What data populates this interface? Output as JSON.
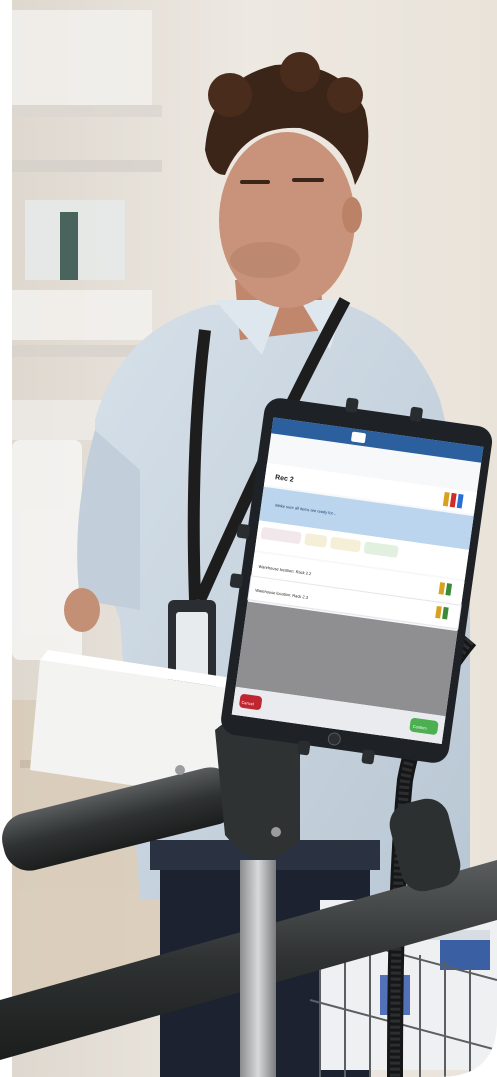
{
  "photo": {
    "alt_subject": "stockroom-worker-with-tablet-on-cart",
    "colors": {
      "wall": "#ece7df",
      "shirt": "#c9d6e2",
      "hair": "#3b2418",
      "skin": "#c8937a",
      "lanyard": "#1d1d1d",
      "cart_frame": "#3a3c3c",
      "tablet_body": "#1e2226",
      "app_header": "#2b5f9e",
      "app_panel_gray": "#8f8f91",
      "cancel_red": "#c0262f",
      "confirm_green": "#4caf50"
    }
  },
  "tablet": {
    "screen_title": "Rec 2",
    "info_banner": "Make sure all items are ready for...",
    "rows": [
      {
        "label": "Warehouse location: Rack 2.2"
      },
      {
        "label": "Warehouse location: Rack 2.3"
      }
    ],
    "cancel_label": "Cancel",
    "confirm_label": "Confirm"
  }
}
